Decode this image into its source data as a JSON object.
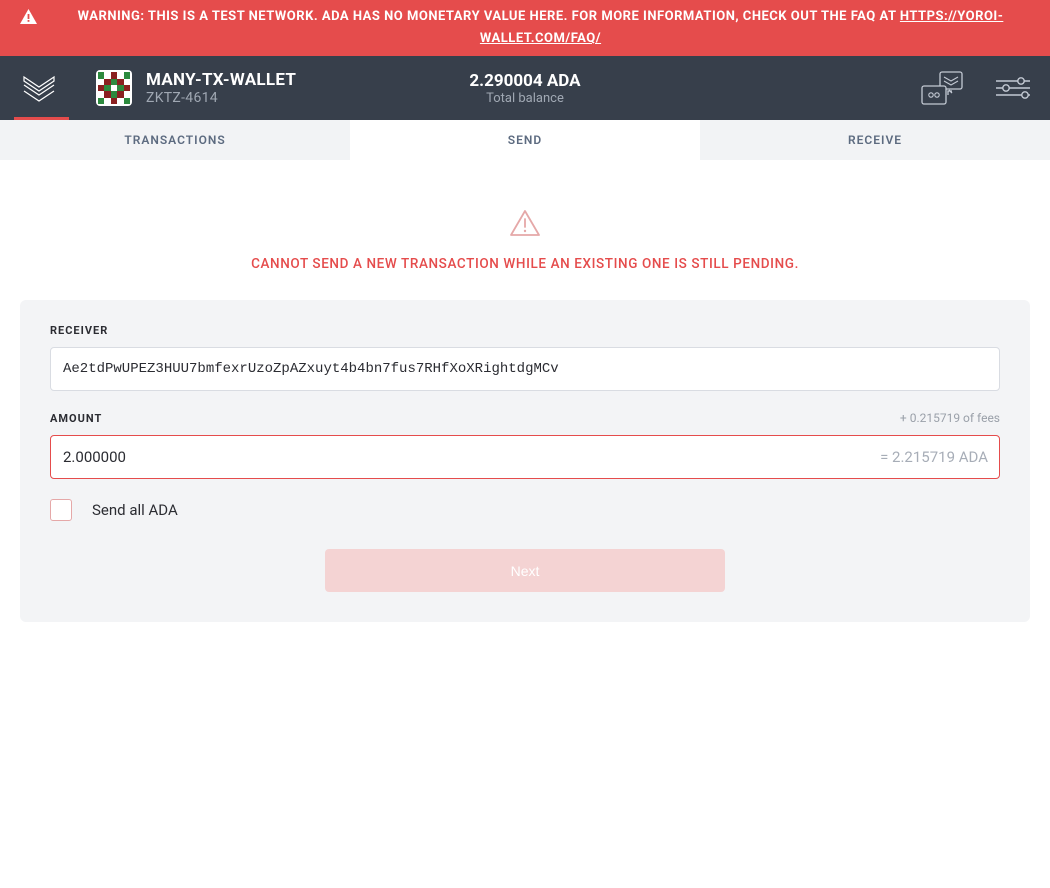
{
  "warning": {
    "text": "WARNING: THIS IS A TEST NETWORK. ADA HAS NO MONETARY VALUE HERE. FOR MORE INFORMATION, CHECK OUT THE FAQ AT ",
    "link_text": "HTTPS://YOROI-WALLET.COM/FAQ/"
  },
  "wallet": {
    "name": "MANY-TX-WALLET",
    "plate": "ZKTZ-4614"
  },
  "balance": {
    "amount": "2.290004 ADA",
    "label": "Total balance"
  },
  "tabs": {
    "transactions": "TRANSACTIONS",
    "send": "SEND",
    "receive": "RECEIVE"
  },
  "send": {
    "pending_warning": "CANNOT SEND A NEW TRANSACTION WHILE AN EXISTING ONE IS STILL PENDING.",
    "receiver_label": "RECEIVER",
    "receiver_value": "Ae2tdPwUPEZ3HUU7bmfexrUzoZpAZxuyt4b4bn7fus7RHfXoXRightdgMCv",
    "amount_label": "AMOUNT",
    "amount_value": "2.000000",
    "fees_text": "+ 0.215719 of fees",
    "total_text": "= 2.215719 ADA",
    "send_all_label": "Send all ADA",
    "next_label": "Next"
  },
  "colors": {
    "danger": "#E54C4C",
    "topbar_bg": "#373f4b",
    "card_bg": "#f3f4f6"
  }
}
